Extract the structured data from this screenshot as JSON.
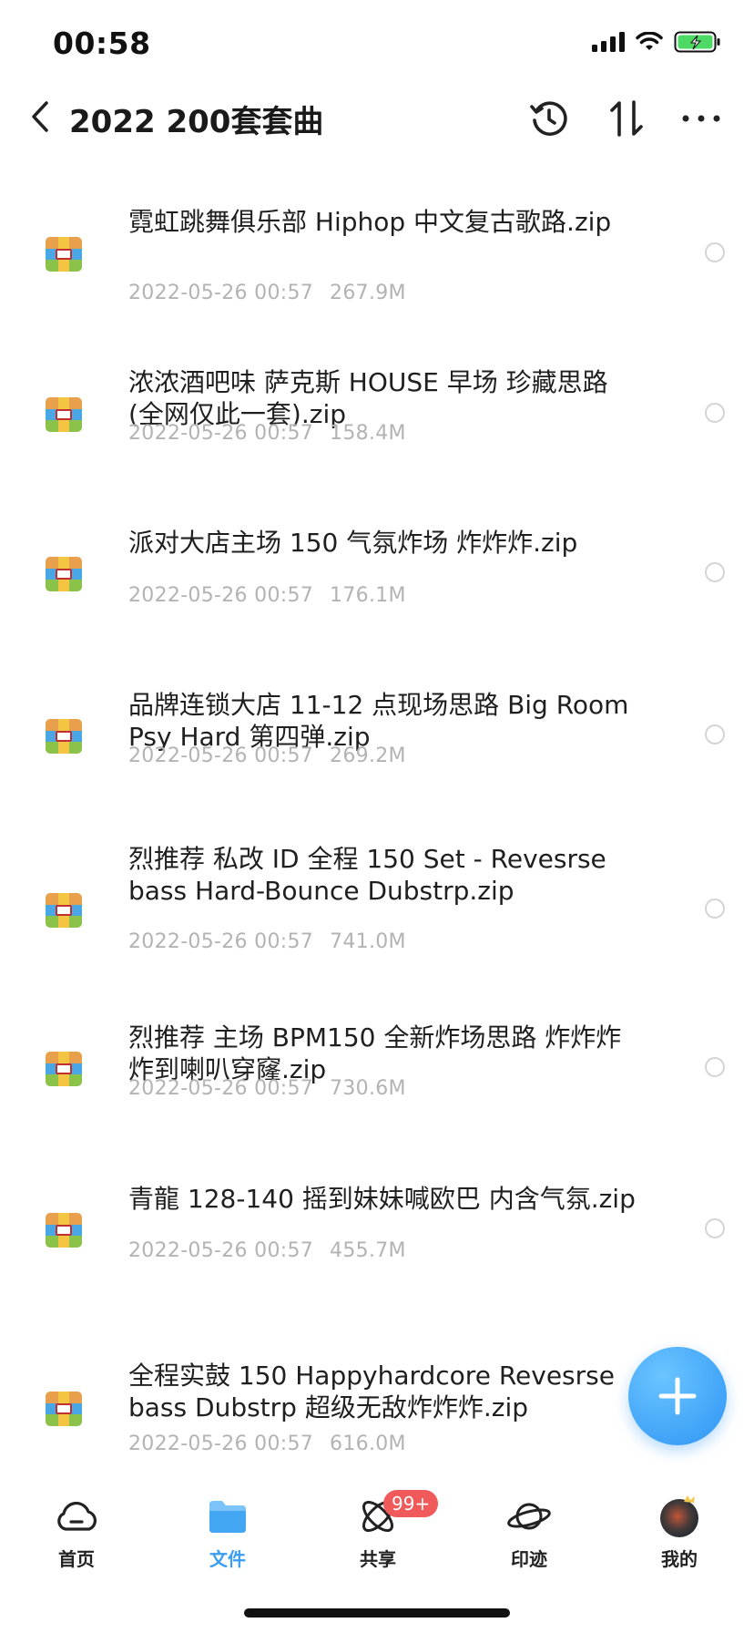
{
  "status_bar": {
    "time": "00:58"
  },
  "header": {
    "title": "2022 200套套曲"
  },
  "files": [
    {
      "name": "霓虹跳舞俱乐部 Hiphop 中文复古歌路.zip",
      "date": "2022-05-26 00:57",
      "size": "267.9M"
    },
    {
      "name": "浓浓酒吧味 萨克斯 HOUSE 早场 珍藏思路 (全网仅此一套).zip",
      "date": "2022-05-26 00:57",
      "size": "158.4M"
    },
    {
      "name": "派对大店主场 150 气氛炸场 炸炸炸.zip",
      "date": "2022-05-26 00:57",
      "size": "176.1M"
    },
    {
      "name": "品牌连锁大店 11-12 点现场思路 Big Room Psy Hard 第四弹.zip",
      "date": "2022-05-26 00:57",
      "size": "269.2M"
    },
    {
      "name": "烈推荐 私改 ID 全程 150 Set - Revesrse bass Hard-Bounce Dubstrp.zip",
      "date": "2022-05-26 00:57",
      "size": "741.0M"
    },
    {
      "name": "烈推荐 主场 BPM150 全新炸场思路 炸炸炸 炸到喇叭穿窿.zip",
      "date": "2022-05-26 00:57",
      "size": "730.6M"
    },
    {
      "name": "青龍 128-140 摇到妹妹喊欧巴 内含气氛.zip",
      "date": "2022-05-26 00:57",
      "size": "455.7M"
    },
    {
      "name": "全程实鼓 150 Happyhardcore Revesrse bass Dubstrp 超级无敌炸炸炸.zip",
      "date": "2022-05-26 00:57",
      "size": "616.0M"
    }
  ],
  "tabs": [
    {
      "label": "首页",
      "icon": "home-cloud-icon"
    },
    {
      "label": "文件",
      "icon": "folder-icon"
    },
    {
      "label": "共享",
      "icon": "share-orbit-icon",
      "badge": "99+"
    },
    {
      "label": "印迹",
      "icon": "planet-icon"
    },
    {
      "label": "我的",
      "icon": "avatar-icon"
    }
  ],
  "colors": {
    "accent": "#3a9df2",
    "badge": "#f05a5a",
    "meta_text": "#b3b3b3"
  }
}
